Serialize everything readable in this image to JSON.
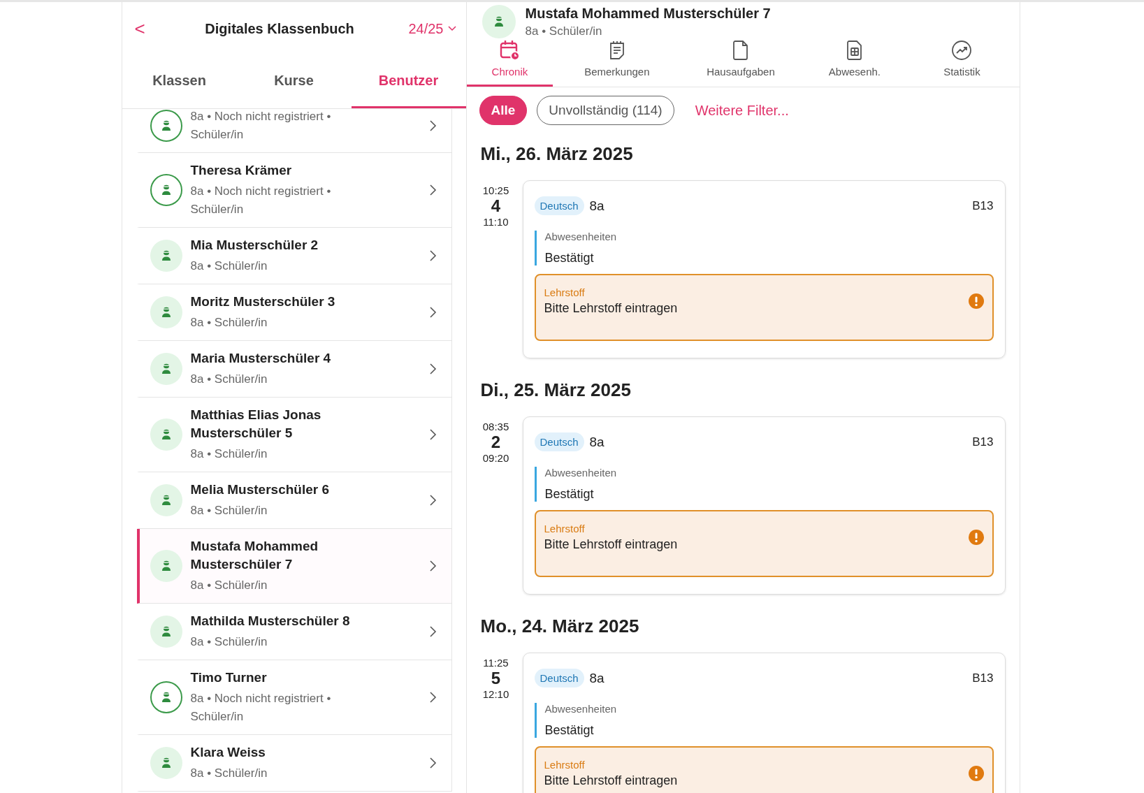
{
  "sidebar": {
    "back": "<",
    "title": "Digitales Klassenbuch",
    "year": "24/25",
    "tabs": [
      {
        "label": "Klassen",
        "selected": false
      },
      {
        "label": "Kurse",
        "selected": false
      },
      {
        "label": "Benutzer",
        "selected": true
      }
    ],
    "users": [
      {
        "sub": "8a • Noch nicht registriert • Schüler/in",
        "registered": false,
        "selected": false
      },
      {
        "name": "Theresa Krämer",
        "sub": "8a • Noch nicht registriert • Schüler/in",
        "registered": false,
        "selected": false
      },
      {
        "name": "Mia Musterschüler 2",
        "sub": "8a • Schüler/in",
        "registered": true,
        "selected": false
      },
      {
        "name": "Moritz Musterschüler 3",
        "sub": "8a • Schüler/in",
        "registered": true,
        "selected": false
      },
      {
        "name": "Maria Musterschüler 4",
        "sub": "8a • Schüler/in",
        "registered": true,
        "selected": false
      },
      {
        "name": "Matthias Elias Jonas Musterschüler 5",
        "sub": "8a • Schüler/in",
        "registered": true,
        "selected": false
      },
      {
        "name": "Melia Musterschüler 6",
        "sub": "8a • Schüler/in",
        "registered": true,
        "selected": false
      },
      {
        "name": "Mustafa Mohammed Musterschüler 7",
        "sub": "8a • Schüler/in",
        "registered": true,
        "selected": true
      },
      {
        "name": "Mathilda Musterschüler 8",
        "sub": "8a • Schüler/in",
        "registered": true,
        "selected": false
      },
      {
        "name": "Timo Turner",
        "sub": "8a • Noch nicht registriert • Schüler/in",
        "registered": false,
        "selected": false
      },
      {
        "name": "Klara Weiss",
        "sub": "8a • Schüler/in",
        "registered": true,
        "selected": false
      }
    ]
  },
  "detail": {
    "name": "Mustafa Mohammed Musterschüler 7",
    "sub": "8a • Schüler/in",
    "tabs": [
      {
        "label": "Chronik",
        "selected": true
      },
      {
        "label": "Bemerkungen",
        "selected": false
      },
      {
        "label": "Hausaufgaben",
        "selected": false
      },
      {
        "label": "Abwesenh.",
        "selected": false
      },
      {
        "label": "Statistik",
        "selected": false
      }
    ],
    "filters": [
      {
        "label": "Alle",
        "selected": true
      },
      {
        "label": "Unvollständig (114)",
        "selected": false
      }
    ],
    "more_filters": "Weitere Filter...",
    "days": [
      {
        "date": "Mi., 26. März 2025",
        "lessons": [
          {
            "start": "10:25",
            "period": "4",
            "end": "11:10",
            "subject": "Deutsch",
            "class": "8a",
            "room": "B13",
            "absence_label": "Abwesenheiten",
            "absence_value": "Bestätigt",
            "topic_label": "Lehrstoff",
            "topic_value": "Bitte Lehrstoff eintragen",
            "warning": true
          }
        ]
      },
      {
        "date": "Di., 25. März 2025",
        "lessons": [
          {
            "start": "08:35",
            "period": "2",
            "end": "09:20",
            "subject": "Deutsch",
            "class": "8a",
            "room": "B13",
            "absence_label": "Abwesenheiten",
            "absence_value": "Bestätigt",
            "topic_label": "Lehrstoff",
            "topic_value": "Bitte Lehrstoff eintragen",
            "warning": true
          }
        ]
      },
      {
        "date": "Mo., 24. März 2025",
        "lessons": [
          {
            "start": "11:25",
            "period": "5",
            "end": "12:10",
            "subject": "Deutsch",
            "class": "8a",
            "room": "B13",
            "absence_label": "Abwesenheiten",
            "absence_value": "Bestätigt",
            "topic_label": "Lehrstoff",
            "topic_value": "Bitte Lehrstoff eintragen",
            "warning": true
          }
        ]
      }
    ]
  }
}
